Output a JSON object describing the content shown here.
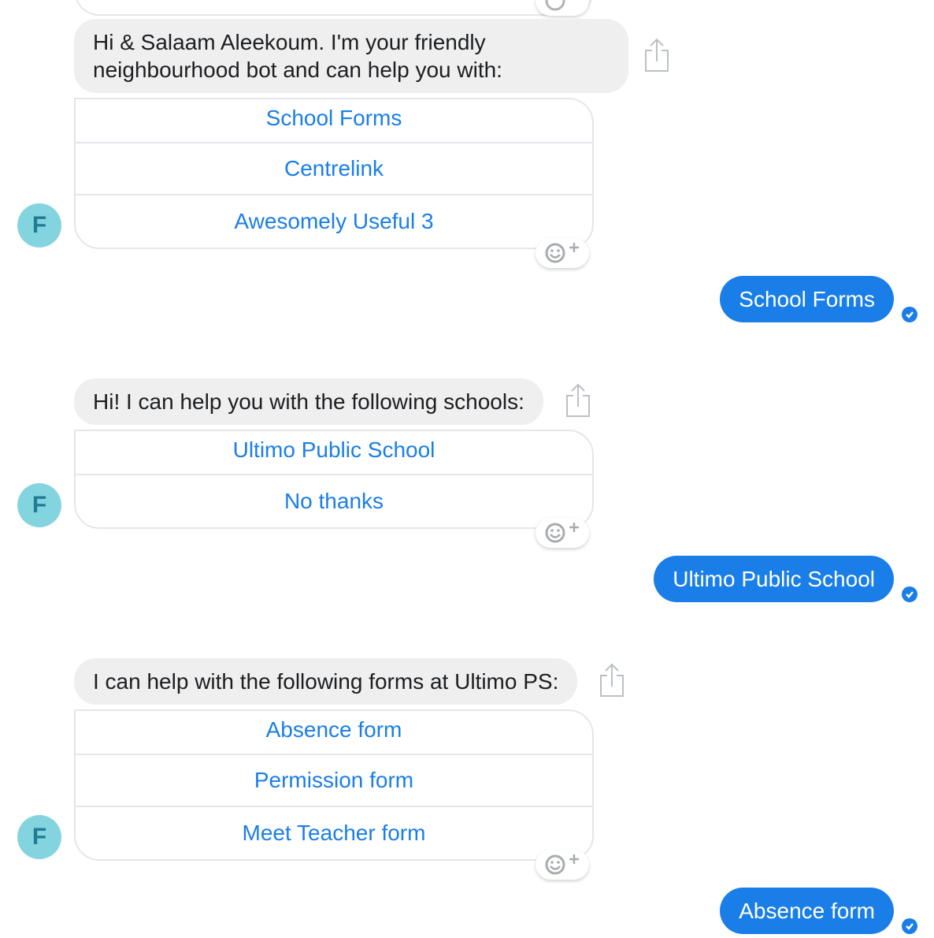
{
  "messages": [
    {
      "from": "bot",
      "text": "Hi & Salaam Aleekoum. I'm your friendly neighbourhood bot and can help you with:",
      "options": [
        "School Forms",
        "Centrelink",
        "Awesomely Useful 3"
      ]
    },
    {
      "from": "user",
      "text": "School Forms"
    },
    {
      "from": "bot",
      "text": "Hi! I can help you with the following schools:",
      "options": [
        "Ultimo Public School",
        "No thanks"
      ]
    },
    {
      "from": "user",
      "text": "Ultimo Public School"
    },
    {
      "from": "bot",
      "text": "I can help with the following forms at Ultimo PS:",
      "options": [
        "Absence form",
        "Permission form",
        "Meet Teacher form"
      ]
    },
    {
      "from": "user",
      "text": "Absence form"
    }
  ],
  "bot": {
    "avatar_letter": "F",
    "avatar_color": "#84d4e0"
  },
  "colors": {
    "accent": "#1a7ee8",
    "incoming_bubble": "#efefef",
    "border": "#e4e6eb"
  },
  "icons": {
    "share": "share-icon",
    "reaction": "add-reaction-icon",
    "delivered": "delivered-check-icon"
  }
}
